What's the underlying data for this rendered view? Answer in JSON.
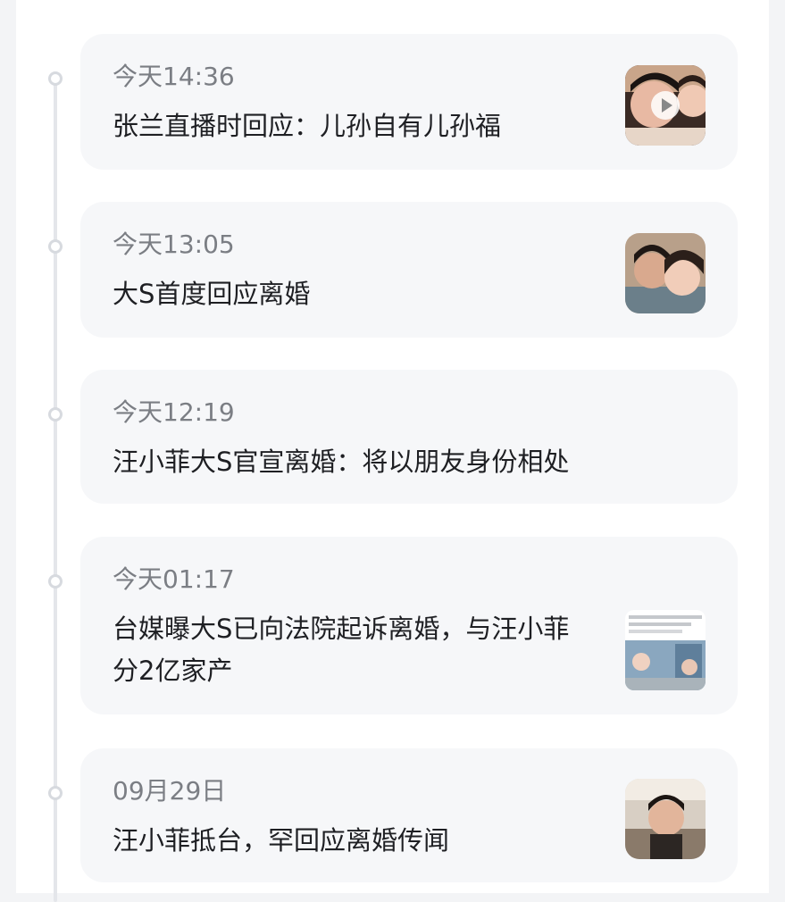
{
  "timeline": {
    "items": [
      {
        "time": "今天14:36",
        "title": "张兰直播时回应：儿孙自有儿孙福",
        "thumbnail": "video-thumbnail",
        "has_video": true
      },
      {
        "time": "今天13:05",
        "title": "大S首度回应离婚",
        "thumbnail": "couple-photo"
      },
      {
        "time": "今天12:19",
        "title": "汪小菲大S官宣离婚：将以朋友身份相处"
      },
      {
        "time": "今天01:17",
        "title": "台媒曝大S已向法院起诉离婚，与汪小菲分2亿家产",
        "thumbnail": "news-screenshot"
      },
      {
        "time": "09月29日",
        "title": "汪小菲抵台，罕回应离婚传闻",
        "thumbnail": "selfie-photo"
      }
    ]
  },
  "colors": {
    "card_background": "#f6f7f9",
    "time_text": "#7b7e84",
    "title_text": "#1e1f23",
    "timeline_line": "#e4e6ea"
  }
}
